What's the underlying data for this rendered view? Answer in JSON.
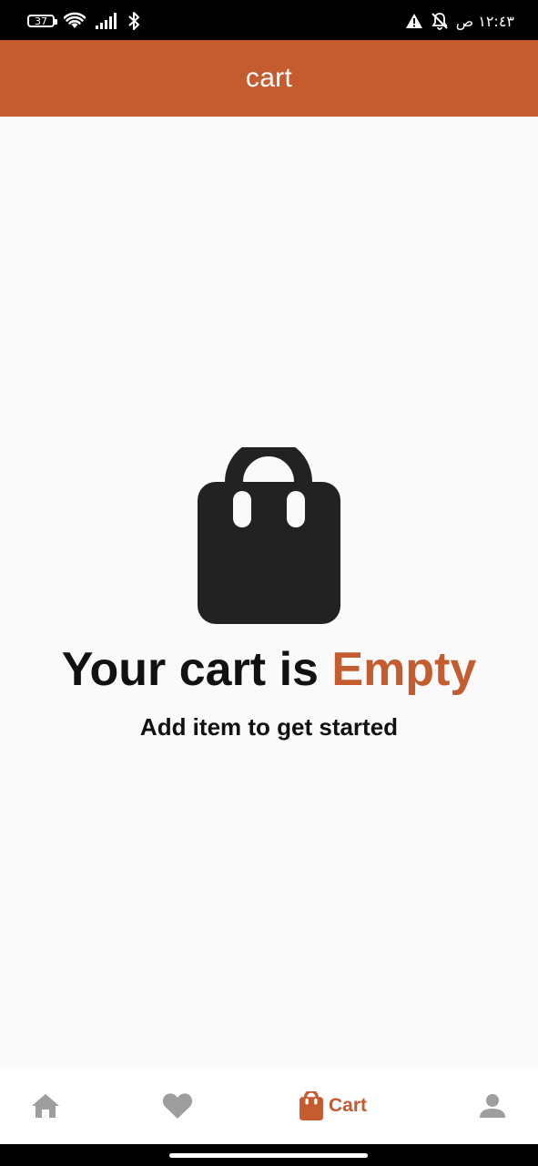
{
  "status_bar": {
    "battery_level": "37",
    "time": "١٢:٤٣ ص"
  },
  "appbar": {
    "title": "cart"
  },
  "empty_state": {
    "headline_prefix": "Your cart is ",
    "headline_accent": "Empty",
    "subtitle": "Add item to get started",
    "icon": "shopping-bag-icon"
  },
  "bottom_nav": {
    "items": [
      {
        "icon": "home-icon",
        "label": "",
        "active": false
      },
      {
        "icon": "heart-icon",
        "label": "",
        "active": false
      },
      {
        "icon": "shopping-bag-icon",
        "label": "Cart",
        "active": true
      },
      {
        "icon": "person-icon",
        "label": "",
        "active": false
      }
    ],
    "active_color": "#C45C30",
    "inactive_color": "#9E9E9E"
  },
  "colors": {
    "accent": "#C45C30",
    "background": "#FAFAFA",
    "status_bar": "#000000",
    "text": "#111111",
    "icon_dark": "#222222"
  }
}
